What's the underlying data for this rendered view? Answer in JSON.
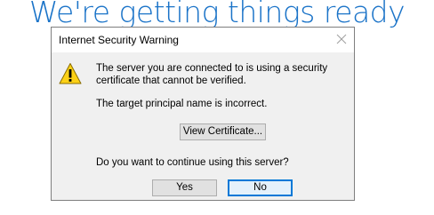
{
  "background": {
    "title": "We're getting things ready"
  },
  "dialog": {
    "title": "Internet Security Warning",
    "icon": "warning-triangle-icon",
    "message_line1": "The server you are connected to is using a security certificate that cannot be verified.",
    "message_line2": "The target principal name is incorrect.",
    "question": "Do you want to continue using this server?",
    "view_certificate_label": "View Certificate...",
    "yes_label": "Yes",
    "no_label": "No",
    "default_button": "No"
  },
  "colors": {
    "accent": "#0078d7",
    "background_title": "#1a73c8",
    "warning_fill": "#fcd116"
  }
}
